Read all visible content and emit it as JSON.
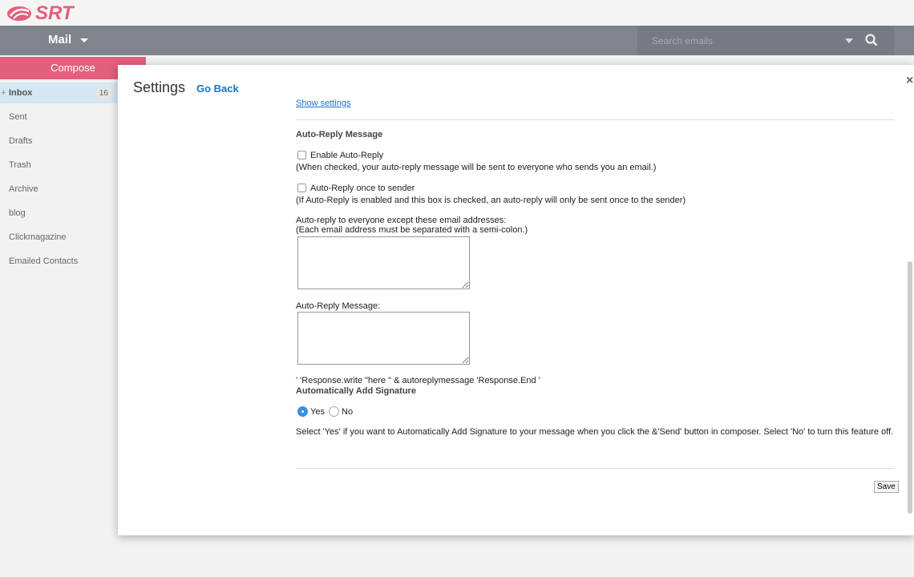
{
  "brand": {
    "logo_text": "SRT",
    "color": "#e2607c"
  },
  "nav": {
    "app": "Mail",
    "search_placeholder": "Search emails"
  },
  "sidebar": {
    "compose": "Compose",
    "folders": [
      {
        "label": "Inbox",
        "count": "16",
        "active": true
      },
      {
        "label": "Sent"
      },
      {
        "label": "Drafts"
      },
      {
        "label": "Trash"
      },
      {
        "label": "Archive"
      },
      {
        "label": "blog"
      },
      {
        "label": "Clickmagazine"
      },
      {
        "label": "Emailed Contacts"
      }
    ]
  },
  "settings": {
    "title": "Settings",
    "go_back": "Go Back",
    "show_settings": "Show settings",
    "auto_reply_heading": "Auto-Reply Message",
    "enable_label": "Enable Auto-Reply",
    "enable_checked": false,
    "enable_help": "(When checked, your auto-reply message will be sent to everyone who sends you an email.)",
    "once_label": "Auto-Reply once to sender",
    "once_checked": false,
    "once_help": "(If Auto-Reply is enabled and this box is checked, an auto-reply will only be sent once to the sender)",
    "except_label": "Auto-reply to everyone except these email addresses:",
    "except_help": "(Each email address must be separated with a semi-colon.)",
    "except_value": "",
    "message_label": "Auto-Reply Message:",
    "message_value": "",
    "code_text": "' 'Response.write \"here \" & autoreplymessage 'Response.End '",
    "signature_heading": "Automatically Add Signature",
    "yes": "Yes",
    "no": "No",
    "signature_selected": "Yes",
    "signature_help": "Select 'Yes' if you want to Automatically Add Signature to your message when you click the &'Send' button in composer. Select 'No' to turn this feature off.",
    "save": "Save"
  }
}
